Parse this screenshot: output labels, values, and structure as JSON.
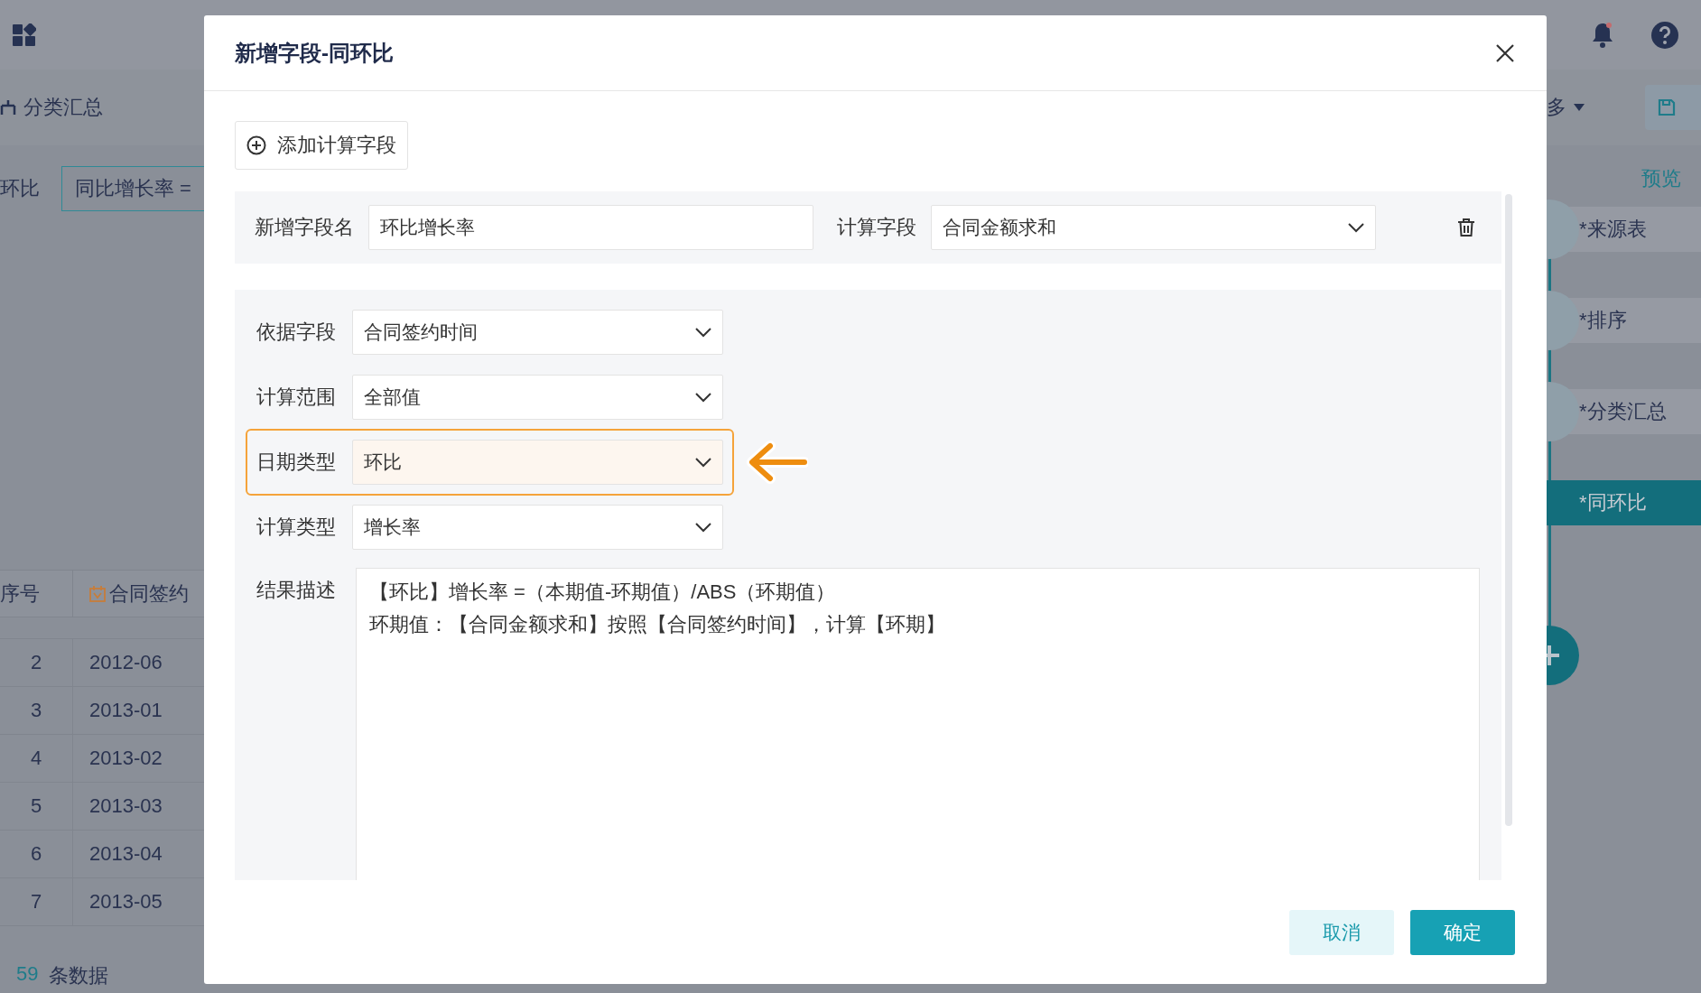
{
  "background": {
    "toolbar": {
      "left_item": "分类汇总",
      "more": "多"
    },
    "formula": {
      "label": "环比",
      "value": "同比增长率 ="
    },
    "preview_link": "预览",
    "pipeline": [
      {
        "label": "*来源表",
        "selected": false
      },
      {
        "label": "*排序",
        "selected": false
      },
      {
        "label": "*分类汇总",
        "selected": false
      },
      {
        "label": "*同环比",
        "selected": true
      }
    ],
    "table": {
      "columns": [
        "序号",
        "合同签约"
      ],
      "rows": [
        [
          "2",
          "2012-06"
        ],
        [
          "3",
          "2013-01"
        ],
        [
          "4",
          "2013-02"
        ],
        [
          "5",
          "2013-03"
        ],
        [
          "6",
          "2013-04"
        ],
        [
          "7",
          "2013-05"
        ]
      ]
    },
    "footer": {
      "count": "59",
      "unit": "条数据"
    }
  },
  "dialog": {
    "title": "新增字段-同环比",
    "add_button": "添加计算字段",
    "name_row": {
      "name_label": "新增字段名",
      "name_value": "环比增长率",
      "field_label": "计算字段",
      "field_value": "合同金额求和"
    },
    "settings": [
      {
        "label": "依据字段",
        "value": "合同签约时间",
        "highlighted": false
      },
      {
        "label": "计算范围",
        "value": "全部值",
        "highlighted": false
      },
      {
        "label": "日期类型",
        "value": "环比",
        "highlighted": true
      },
      {
        "label": "计算类型",
        "value": "增长率",
        "highlighted": false
      }
    ],
    "result": {
      "label": "结果描述",
      "lines": [
        "【环比】增长率 =（本期值-环期值）/ABS（环期值）",
        "环期值：【合同金额求和】按照【合同签约时间】，计算【环期】"
      ]
    },
    "buttons": [
      {
        "label": "取消",
        "kind": "secondary"
      },
      {
        "label": "确定",
        "kind": "primary"
      }
    ]
  }
}
